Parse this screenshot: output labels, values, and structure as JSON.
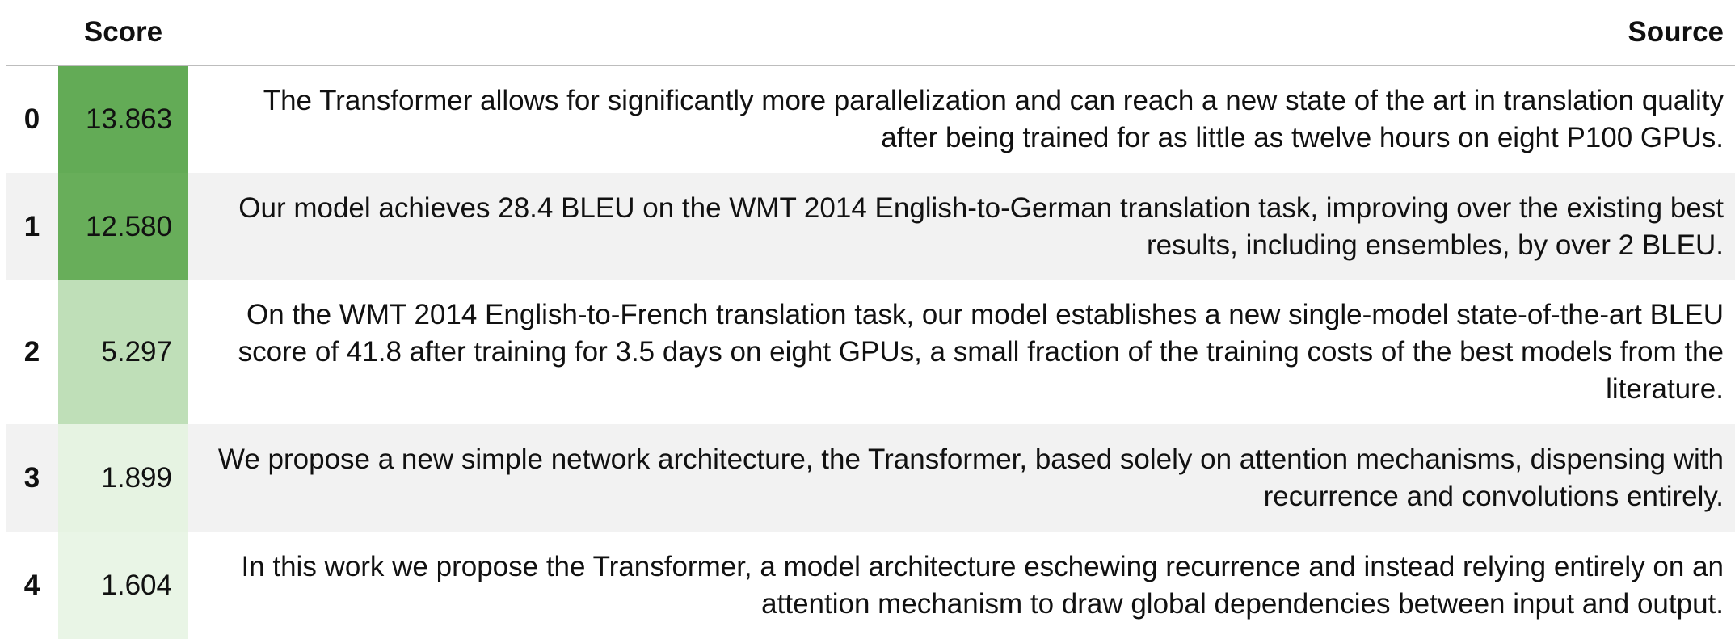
{
  "table": {
    "headers": {
      "index": "",
      "score": "Score",
      "source": "Source"
    },
    "colors": {
      "score_dark": "#63ab56",
      "score_mid": "#bfdfb8",
      "score_light": "#e8f4e4",
      "stripe": "#f2f2f2"
    },
    "rows": [
      {
        "index": "0",
        "score": "13.863",
        "source": "The Transformer allows for significantly more parallelization and can reach a new state of the art in translation quality after being trained for as little as twelve hours on eight P100 GPUs."
      },
      {
        "index": "1",
        "score": "12.580",
        "source": "Our model achieves 28.4 BLEU on the WMT 2014 English-to-German translation task, improving over the existing best results, including ensembles, by over 2 BLEU."
      },
      {
        "index": "2",
        "score": "5.297",
        "source": "On the WMT 2014 English-to-French translation task, our model establishes a new single-model state-of-the-art BLEU score of 41.8 after training for 3.5 days on eight GPUs, a small fraction of the training costs of the best models from the literature."
      },
      {
        "index": "3",
        "score": "1.899",
        "source": "We propose a new simple network architecture, the Transformer, based solely on attention mechanisms, dispensing with recurrence and convolutions entirely."
      },
      {
        "index": "4",
        "score": "1.604",
        "source": "In this work we propose the Transformer, a model architecture eschewing recurrence and instead relying entirely on an attention mechanism to draw global dependencies between input and output."
      }
    ]
  }
}
